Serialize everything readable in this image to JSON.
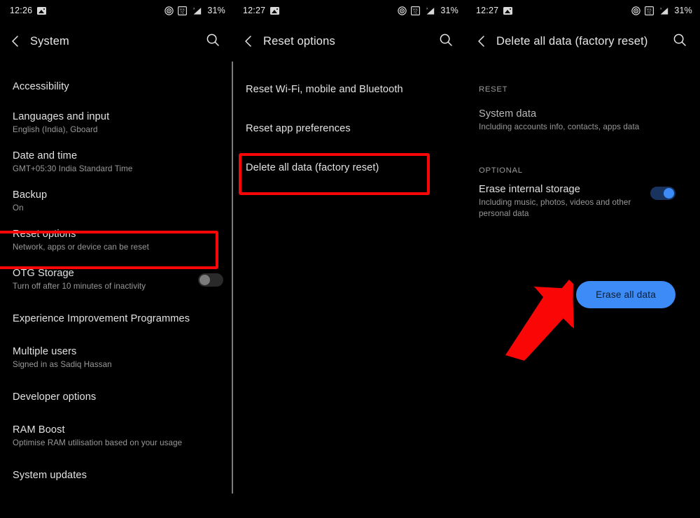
{
  "status_bar": {
    "left_time_1": "12:26",
    "left_time_2": "12:27",
    "left_time_3": "12:27",
    "photo_icon": "photo-icon",
    "cast_icon": "cast-icon",
    "volte_icon": "volte-icon",
    "signal_icon": "signal-no-sim-icon",
    "battery": "31%"
  },
  "colors": {
    "accent_blue": "#3d8bf7",
    "toggle_track_on": "#18335e",
    "highlight_red": "#fb0606",
    "background": "#000000",
    "primary_text": "#e3e3e3",
    "secondary_text": "#9a9a9a"
  },
  "panel_system": {
    "title": "System",
    "back_icon": "back-chevron-icon",
    "search_icon": "search-icon",
    "items": [
      {
        "title": "Accessibility",
        "subtitle": ""
      },
      {
        "title": "Languages and input",
        "subtitle": "English (India), Gboard"
      },
      {
        "title": "Date and time",
        "subtitle": "GMT+05:30 India Standard Time"
      },
      {
        "title": "Backup",
        "subtitle": "On"
      },
      {
        "title": "Reset options",
        "subtitle": "Network, apps or device can be reset"
      },
      {
        "title": "OTG Storage",
        "subtitle": "Turn off after 10 minutes of inactivity",
        "toggle": "off"
      },
      {
        "title": "Experience Improvement Programmes",
        "subtitle": ""
      },
      {
        "title": "Multiple users",
        "subtitle": "Signed in as Sadiq Hassan"
      },
      {
        "title": "Developer options",
        "subtitle": ""
      },
      {
        "title": "RAM Boost",
        "subtitle": "Optimise RAM utilisation based on your usage"
      },
      {
        "title": "System updates",
        "subtitle": ""
      }
    ]
  },
  "panel_reset": {
    "title": "Reset options",
    "back_icon": "back-chevron-icon",
    "search_icon": "search-icon",
    "items": [
      {
        "title": "Reset Wi-Fi, mobile and Bluetooth"
      },
      {
        "title": "Reset app preferences"
      },
      {
        "title": "Delete all data (factory reset)"
      }
    ]
  },
  "panel_factory_reset": {
    "title": "Delete all data (factory reset)",
    "back_icon": "back-chevron-icon",
    "search_icon": "search-icon",
    "section_reset_label": "RESET",
    "system_data": {
      "title": "System data",
      "subtitle": "Including accounts info, contacts, apps data"
    },
    "section_optional_label": "OPTIONAL",
    "erase_internal_storage": {
      "title": "Erase internal storage",
      "subtitle": "Including music, photos, videos and other personal data",
      "toggle": "on"
    },
    "erase_button_label": "Erase all data"
  },
  "annotations": {
    "highlight_1_target": "Reset options",
    "highlight_2_target": "Delete all data (factory reset)",
    "arrow_target": "Erase all data"
  }
}
